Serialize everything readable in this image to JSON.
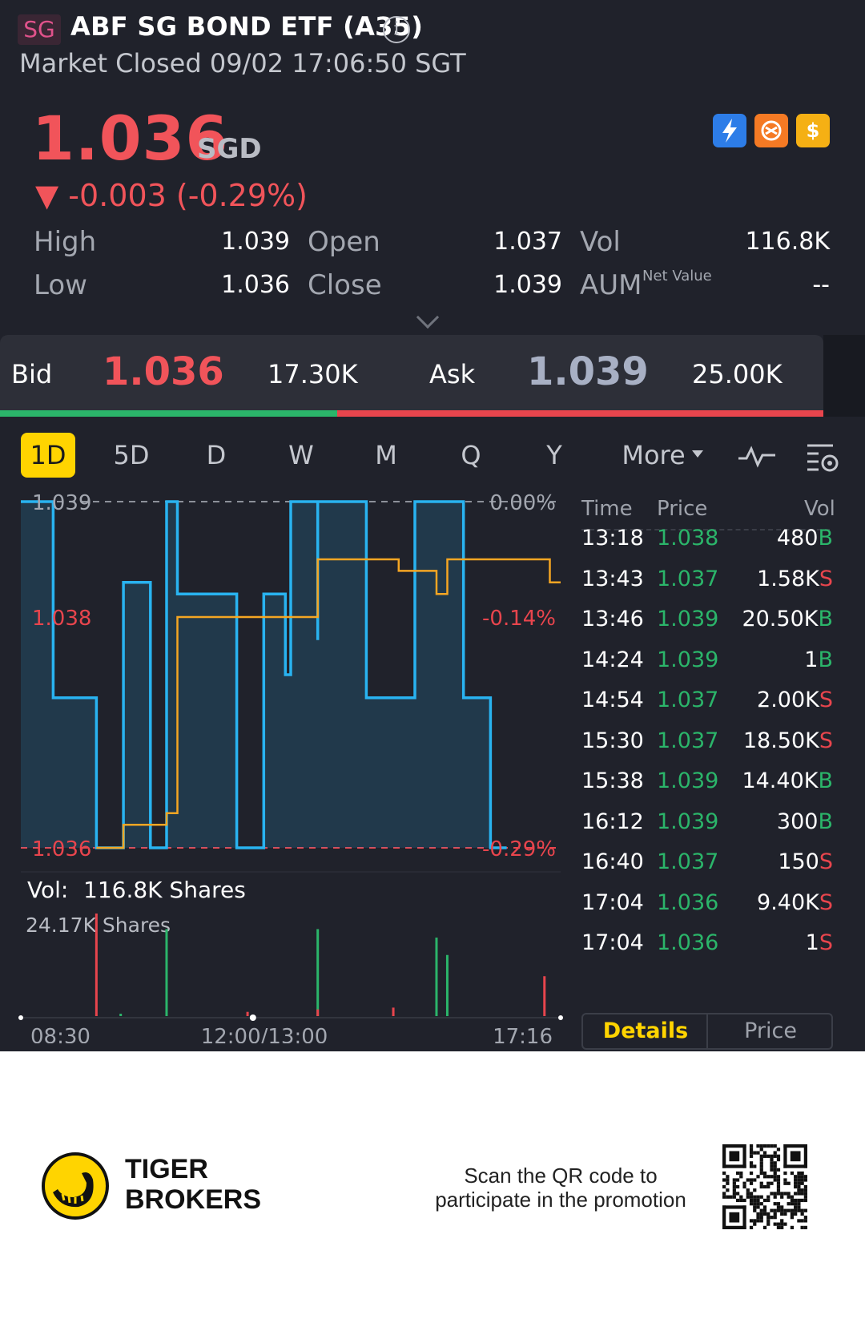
{
  "header": {
    "market_badge": "SG",
    "title": "ABF SG BOND ETF (A35)",
    "status": "Market Closed 09/02 17:06:50 SGT"
  },
  "quote": {
    "price": "1.036",
    "currency": "SGD",
    "change": "▼ -0.003 (-0.29%)",
    "stats": [
      {
        "label": "High",
        "value": "1.039"
      },
      {
        "label": "Low",
        "value": "1.036"
      },
      {
        "label": "Open",
        "value": "1.037"
      },
      {
        "label": "Close",
        "value": "1.039"
      },
      {
        "label": "Vol",
        "value": "116.8K"
      },
      {
        "label": "AUM",
        "value": "--",
        "sup": "Net Value"
      }
    ]
  },
  "bidask": {
    "bid_label": "Bid",
    "bid_price": "1.036",
    "bid_size": "17.30K",
    "ask_label": "Ask",
    "ask_price": "1.039",
    "ask_size": "25.00K",
    "bid_share": 0.41
  },
  "periods": [
    "1D",
    "5D",
    "D",
    "W",
    "M",
    "Q",
    "Y",
    "More"
  ],
  "chart_data": {
    "type": "line",
    "y_tick_labels": [
      "1.039",
      "1.038",
      "1.036"
    ],
    "pct_tick_labels": [
      "0.00%",
      "-0.14%",
      "-0.29%"
    ],
    "x_tick_labels": [
      "08:30",
      "12:00/13:00",
      "17:16"
    ],
    "ylim": [
      1.036,
      1.039
    ],
    "prev_close": 1.039,
    "series": [
      {
        "color": "#29b3f0",
        "x": [
          0,
          0.06,
          0.06,
          0.14,
          0.14,
          0.19,
          0.19,
          0.24,
          0.24,
          0.27,
          0.27,
          0.29,
          0.29,
          0.3,
          0.3,
          0.4,
          0.4,
          0.45,
          0.45,
          0.49,
          0.49,
          0.5,
          0.5,
          0.55,
          0.55,
          0.55,
          0.55,
          0.64,
          0.64,
          0.73,
          0.73,
          0.82,
          0.82,
          0.87,
          0.87,
          0.9
        ],
        "y": [
          1.039,
          1.039,
          1.0373,
          1.0373,
          1.036,
          1.036,
          1.0383,
          1.0383,
          1.036,
          1.036,
          1.039,
          1.039,
          1.0382,
          1.0382,
          1.0382,
          1.0382,
          1.036,
          1.036,
          1.0382,
          1.0382,
          1.0375,
          1.0375,
          1.039,
          1.039,
          1.0378,
          1.0378,
          1.039,
          1.039,
          1.0373,
          1.0373,
          1.039,
          1.039,
          1.0373,
          1.0373,
          1.036,
          1.036
        ]
      },
      {
        "color": "#f5a623",
        "x": [
          0.14,
          0.19,
          0.19,
          0.27,
          0.27,
          0.29,
          0.29,
          0.55,
          0.55,
          0.55,
          0.55,
          0.7,
          0.7,
          0.77,
          0.77,
          0.79,
          0.79,
          0.98,
          0.98,
          1.0
        ],
        "y": [
          1.036,
          1.036,
          1.0362,
          1.0362,
          1.0363,
          1.0363,
          1.038,
          1.038,
          1.038,
          1.0381,
          1.0385,
          1.0385,
          1.0384,
          1.0384,
          1.0382,
          1.0382,
          1.0385,
          1.0385,
          1.0383,
          1.0383
        ]
      }
    ],
    "volume": {
      "label": "Vol:",
      "total": "116.8K Shares",
      "max_label": "24.17K Shares",
      "bars": [
        {
          "x": 0.14,
          "v": 24.17,
          "side": "S"
        },
        {
          "x": 0.185,
          "v": 0.5,
          "side": "B"
        },
        {
          "x": 0.27,
          "v": 20.5,
          "side": "B"
        },
        {
          "x": 0.42,
          "v": 1.0,
          "side": "S"
        },
        {
          "x": 0.55,
          "v": 20.5,
          "side": "B"
        },
        {
          "x": 0.55,
          "v": 1.58,
          "side": "S"
        },
        {
          "x": 0.69,
          "v": 2.0,
          "side": "S"
        },
        {
          "x": 0.77,
          "v": 18.5,
          "side": "B"
        },
        {
          "x": 0.79,
          "v": 14.4,
          "side": "B"
        },
        {
          "x": 0.97,
          "v": 9.4,
          "side": "S"
        }
      ]
    }
  },
  "trades": {
    "headers": [
      "Time",
      "Price",
      "Vol"
    ],
    "rows": [
      {
        "time": "13:18",
        "price": "1.038",
        "vol": "480",
        "side": "B"
      },
      {
        "time": "13:43",
        "price": "1.037",
        "vol": "1.58K",
        "side": "S"
      },
      {
        "time": "13:46",
        "price": "1.039",
        "vol": "20.50K",
        "side": "B"
      },
      {
        "time": "14:24",
        "price": "1.039",
        "vol": "1",
        "side": "B"
      },
      {
        "time": "14:54",
        "price": "1.037",
        "vol": "2.00K",
        "side": "S"
      },
      {
        "time": "15:30",
        "price": "1.037",
        "vol": "18.50K",
        "side": "S"
      },
      {
        "time": "15:38",
        "price": "1.039",
        "vol": "14.40K",
        "side": "B"
      },
      {
        "time": "16:12",
        "price": "1.039",
        "vol": "300",
        "side": "B"
      },
      {
        "time": "16:40",
        "price": "1.037",
        "vol": "150",
        "side": "S"
      },
      {
        "time": "17:04",
        "price": "1.036",
        "vol": "9.40K",
        "side": "S"
      },
      {
        "time": "17:04",
        "price": "1.036",
        "vol": "1",
        "side": "S"
      }
    ],
    "tabs": [
      "Details",
      "Price"
    ]
  },
  "footer": {
    "brand": [
      "TIGER",
      "BROKERS"
    ],
    "promo": [
      "Scan the QR code to",
      "participate in the promotion"
    ]
  },
  "colors": {
    "up": "#2bb56a",
    "down": "#f1545a",
    "accent": "#ffd400",
    "line_price": "#29b3f0",
    "line_avg": "#f5a623",
    "bg": "#20222b"
  }
}
